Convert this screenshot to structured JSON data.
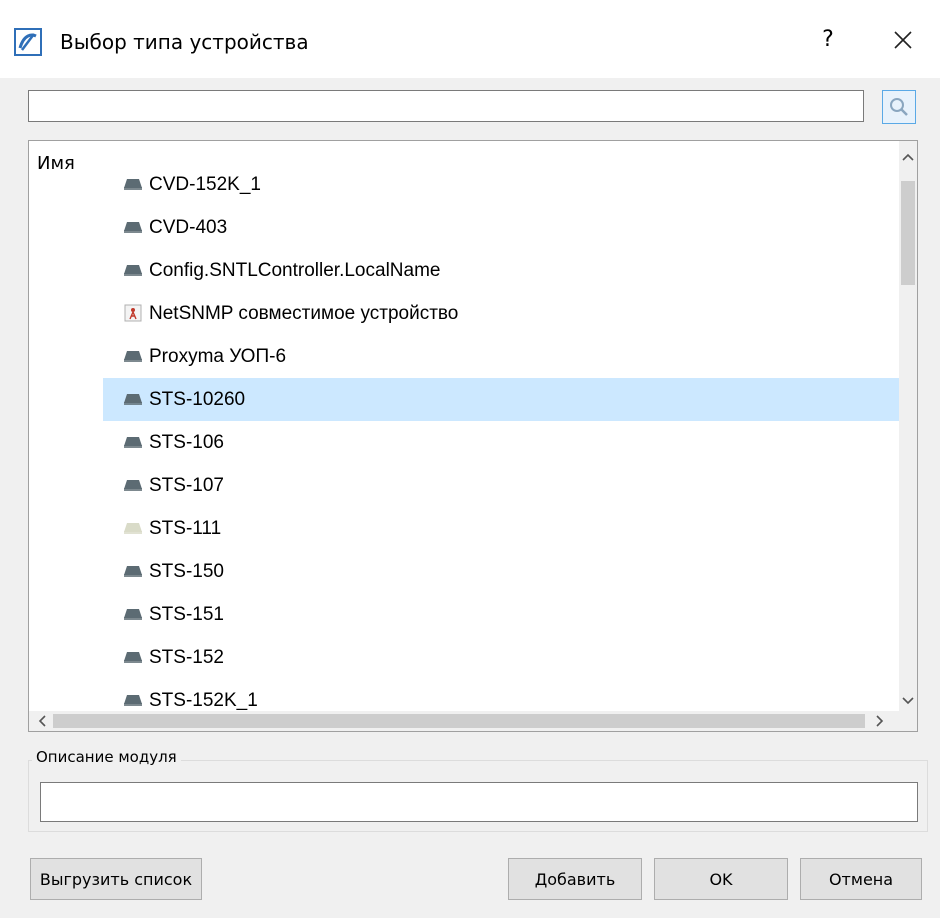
{
  "window": {
    "title": "Выбор типа устройства",
    "help_label": "?"
  },
  "search": {
    "value": "",
    "placeholder": ""
  },
  "list": {
    "column_header": "Имя",
    "items": [
      {
        "label": "CVD-152K_1",
        "icon": "device-icon",
        "selected": false
      },
      {
        "label": "CVD-403",
        "icon": "device-icon",
        "selected": false
      },
      {
        "label": "Config.SNTLController.LocalName",
        "icon": "device-icon",
        "selected": false
      },
      {
        "label": "NetSNMP совместимое устройство",
        "icon": "antenna-icon",
        "selected": false
      },
      {
        "label": "Proxyma УОП-6",
        "icon": "device-icon",
        "selected": false
      },
      {
        "label": "STS-10260",
        "icon": "device-icon",
        "selected": true
      },
      {
        "label": "STS-106",
        "icon": "device-icon",
        "selected": false
      },
      {
        "label": "STS-107",
        "icon": "device-icon",
        "selected": false
      },
      {
        "label": "STS-111",
        "icon": "device-light-icon",
        "selected": false
      },
      {
        "label": "STS-150",
        "icon": "device-icon",
        "selected": false
      },
      {
        "label": "STS-151",
        "icon": "device-icon",
        "selected": false
      },
      {
        "label": "STS-152",
        "icon": "device-icon",
        "selected": false
      },
      {
        "label": "STS-152K_1",
        "icon": "device-icon",
        "selected": false
      }
    ]
  },
  "description": {
    "group_label": "Описание модуля",
    "value": ""
  },
  "buttons": {
    "export": "Выгрузить список",
    "add": "Добавить",
    "ok": "OK",
    "cancel": "Отмена"
  },
  "colors": {
    "selection": "#cce8ff",
    "icon_device": "#5c6b73",
    "icon_light": "#d9dbc8",
    "accent": "#5aa9e6"
  }
}
